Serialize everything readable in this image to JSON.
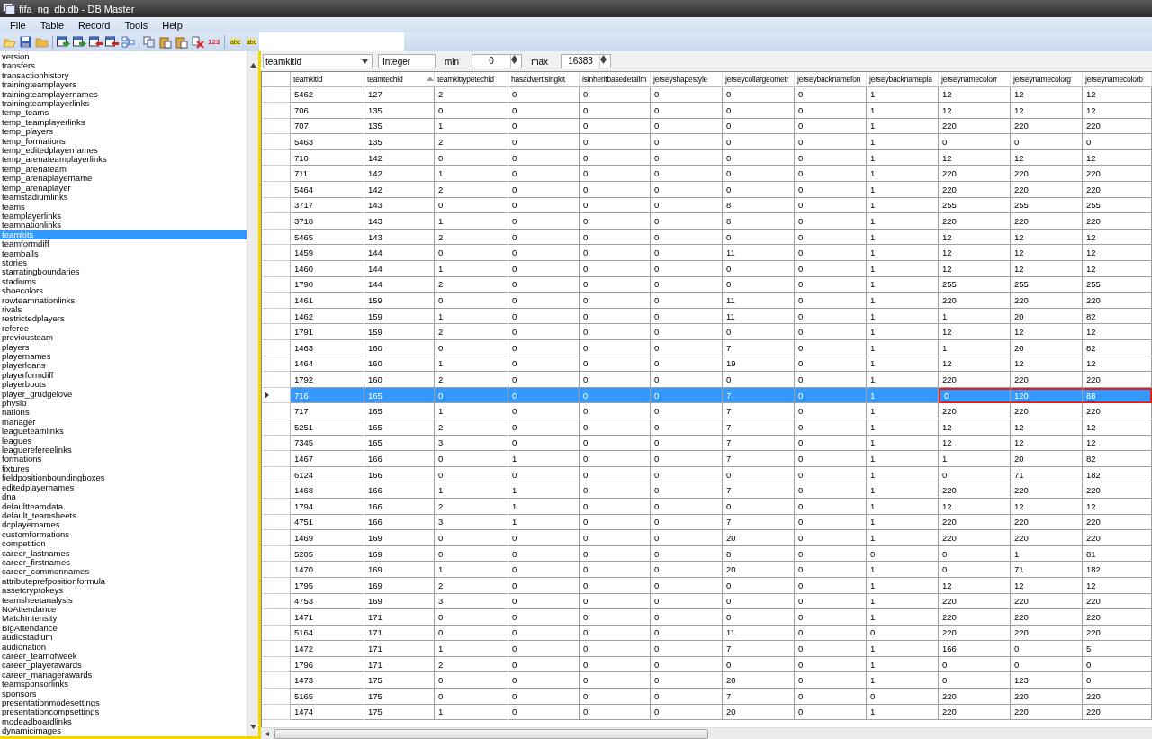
{
  "window": {
    "title": "fifa_ng_db.db - DB Master"
  },
  "menu": [
    "File",
    "Table",
    "Record",
    "Tools",
    "Help"
  ],
  "toolbar": [
    {
      "kind": "open"
    },
    {
      "kind": "save"
    },
    {
      "kind": "folder"
    },
    {
      "kind": "separator"
    },
    {
      "kind": "export"
    },
    {
      "kind": "import"
    },
    {
      "kind": "remove"
    },
    {
      "kind": "remove"
    },
    {
      "kind": "tree"
    },
    {
      "kind": "separator"
    },
    {
      "kind": "copy"
    },
    {
      "kind": "paste"
    },
    {
      "kind": "paste"
    },
    {
      "kind": "delete"
    },
    {
      "kind": "text",
      "label": "123"
    },
    {
      "kind": "separator"
    },
    {
      "kind": "find",
      "label": "abc"
    },
    {
      "kind": "find",
      "label": "abc"
    }
  ],
  "tables": [
    {
      "name": "version",
      "selected": false
    },
    {
      "name": "transfers",
      "selected": false
    },
    {
      "name": "transactionhistory",
      "selected": false
    },
    {
      "name": "trainingteamplayers",
      "selected": false
    },
    {
      "name": "trainingteamplayernames",
      "selected": false
    },
    {
      "name": "trainingteamplayerlinks",
      "selected": false
    },
    {
      "name": "temp_teams",
      "selected": false
    },
    {
      "name": "temp_teamplayerlinks",
      "selected": false
    },
    {
      "name": "temp_players",
      "selected": false
    },
    {
      "name": "temp_formations",
      "selected": false
    },
    {
      "name": "temp_editedplayernames",
      "selected": false
    },
    {
      "name": "temp_arenateamplayerlinks",
      "selected": false
    },
    {
      "name": "temp_arenateam",
      "selected": false
    },
    {
      "name": "temp_arenaplayername",
      "selected": false
    },
    {
      "name": "temp_arenaplayer",
      "selected": false
    },
    {
      "name": "teamstadiumlinks",
      "selected": false
    },
    {
      "name": "teams",
      "selected": false
    },
    {
      "name": "teamplayerlinks",
      "selected": false
    },
    {
      "name": "teamnationlinks",
      "selected": false
    },
    {
      "name": "teamkits",
      "selected": true
    },
    {
      "name": "teamformdiff",
      "selected": false
    },
    {
      "name": "teamballs",
      "selected": false
    },
    {
      "name": "stories",
      "selected": false
    },
    {
      "name": "starratingboundaries",
      "selected": false
    },
    {
      "name": "stadiums",
      "selected": false
    },
    {
      "name": "shoecolors",
      "selected": false
    },
    {
      "name": "rowteamnationlinks",
      "selected": false
    },
    {
      "name": "rivals",
      "selected": false
    },
    {
      "name": "restrictedplayers",
      "selected": false
    },
    {
      "name": "referee",
      "selected": false
    },
    {
      "name": "previousteam",
      "selected": false
    },
    {
      "name": "players",
      "selected": false
    },
    {
      "name": "playernames",
      "selected": false
    },
    {
      "name": "playerloans",
      "selected": false
    },
    {
      "name": "playerformdiff",
      "selected": false
    },
    {
      "name": "playerboots",
      "selected": false
    },
    {
      "name": "player_grudgelove",
      "selected": false
    },
    {
      "name": "physio",
      "selected": false
    },
    {
      "name": "nations",
      "selected": false
    },
    {
      "name": "manager",
      "selected": false
    },
    {
      "name": "leagueteamlinks",
      "selected": false
    },
    {
      "name": "leagues",
      "selected": false
    },
    {
      "name": "leaguerefereelinks",
      "selected": false
    },
    {
      "name": "formations",
      "selected": false
    },
    {
      "name": "fixtures",
      "selected": false
    },
    {
      "name": "fieldpositionboundingboxes",
      "selected": false
    },
    {
      "name": "editedplayernames",
      "selected": false
    },
    {
      "name": "dna",
      "selected": false
    },
    {
      "name": "defaultteamdata",
      "selected": false
    },
    {
      "name": "default_teamsheets",
      "selected": false
    },
    {
      "name": "dcplayernames",
      "selected": false
    },
    {
      "name": "customformations",
      "selected": false
    },
    {
      "name": "competition",
      "selected": false
    },
    {
      "name": "career_lastnames",
      "selected": false
    },
    {
      "name": "career_firstnames",
      "selected": false
    },
    {
      "name": "career_commonnames",
      "selected": false
    },
    {
      "name": "attributeprefpositionformula",
      "selected": false
    },
    {
      "name": "assetcryptokeys",
      "selected": false
    },
    {
      "name": "teamsheetanalysis",
      "selected": false
    },
    {
      "name": "NoAttendance",
      "selected": false
    },
    {
      "name": "MatchIntensity",
      "selected": false
    },
    {
      "name": "BigAttendance",
      "selected": false
    },
    {
      "name": "audiostadium",
      "selected": false
    },
    {
      "name": "audionation",
      "selected": false
    },
    {
      "name": "career_teamofweek",
      "selected": false
    },
    {
      "name": "career_playerawards",
      "selected": false
    },
    {
      "name": "career_managerawards",
      "selected": false
    },
    {
      "name": "teamsponsorlinks",
      "selected": false
    },
    {
      "name": "sponsors",
      "selected": false
    },
    {
      "name": "presentationmodesettings",
      "selected": false
    },
    {
      "name": "presentationcompsettings",
      "selected": false
    },
    {
      "name": "modeadboardlinks",
      "selected": false
    },
    {
      "name": "dynamicimages",
      "selected": false
    }
  ],
  "field_bar": {
    "field": "teamkitid",
    "type": "Integer",
    "min_label": "min",
    "min": "0",
    "max_label": "max",
    "max": "16383"
  },
  "table": {
    "columns": [
      {
        "label": "teamkitid",
        "sorted": false
      },
      {
        "label": "teamtechid",
        "sorted": true
      },
      {
        "label": "teamkittypetechid",
        "sorted": false
      },
      {
        "label": "hasadvertisingkit",
        "sorted": false
      },
      {
        "label": "isinheritbasedetailm",
        "sorted": false
      },
      {
        "label": "jerseyshapestyle",
        "sorted": false
      },
      {
        "label": "jerseycollargeometr",
        "sorted": false
      },
      {
        "label": "jerseybacknamefon",
        "sorted": false
      },
      {
        "label": "jerseybacknamepla",
        "sorted": false
      },
      {
        "label": "jerseynamecolorr",
        "sorted": false
      },
      {
        "label": "jerseynamecolorg",
        "sorted": false
      },
      {
        "label": "jerseynamecolorb",
        "sorted": false
      }
    ],
    "rows": [
      {
        "cells": [
          "5462",
          "127",
          "2",
          "0",
          "0",
          "0",
          "0",
          "0",
          "1",
          "12",
          "12",
          "12"
        ],
        "selected": false
      },
      {
        "cells": [
          "706",
          "135",
          "0",
          "0",
          "0",
          "0",
          "0",
          "0",
          "1",
          "12",
          "12",
          "12"
        ],
        "selected": false
      },
      {
        "cells": [
          "707",
          "135",
          "1",
          "0",
          "0",
          "0",
          "0",
          "0",
          "1",
          "220",
          "220",
          "220"
        ],
        "selected": false
      },
      {
        "cells": [
          "5463",
          "135",
          "2",
          "0",
          "0",
          "0",
          "0",
          "0",
          "1",
          "0",
          "0",
          "0"
        ],
        "selected": false
      },
      {
        "cells": [
          "710",
          "142",
          "0",
          "0",
          "0",
          "0",
          "0",
          "0",
          "1",
          "12",
          "12",
          "12"
        ],
        "selected": false
      },
      {
        "cells": [
          "711",
          "142",
          "1",
          "0",
          "0",
          "0",
          "0",
          "0",
          "1",
          "220",
          "220",
          "220"
        ],
        "selected": false
      },
      {
        "cells": [
          "5464",
          "142",
          "2",
          "0",
          "0",
          "0",
          "0",
          "0",
          "1",
          "220",
          "220",
          "220"
        ],
        "selected": false
      },
      {
        "cells": [
          "3717",
          "143",
          "0",
          "0",
          "0",
          "0",
          "8",
          "0",
          "1",
          "255",
          "255",
          "255"
        ],
        "selected": false
      },
      {
        "cells": [
          "3718",
          "143",
          "1",
          "0",
          "0",
          "0",
          "8",
          "0",
          "1",
          "220",
          "220",
          "220"
        ],
        "selected": false
      },
      {
        "cells": [
          "5465",
          "143",
          "2",
          "0",
          "0",
          "0",
          "0",
          "0",
          "1",
          "12",
          "12",
          "12"
        ],
        "selected": false
      },
      {
        "cells": [
          "1459",
          "144",
          "0",
          "0",
          "0",
          "0",
          "11",
          "0",
          "1",
          "12",
          "12",
          "12"
        ],
        "selected": false
      },
      {
        "cells": [
          "1460",
          "144",
          "1",
          "0",
          "0",
          "0",
          "0",
          "0",
          "1",
          "12",
          "12",
          "12"
        ],
        "selected": false
      },
      {
        "cells": [
          "1790",
          "144",
          "2",
          "0",
          "0",
          "0",
          "0",
          "0",
          "1",
          "255",
          "255",
          "255"
        ],
        "selected": false
      },
      {
        "cells": [
          "1461",
          "159",
          "0",
          "0",
          "0",
          "0",
          "11",
          "0",
          "1",
          "220",
          "220",
          "220"
        ],
        "selected": false
      },
      {
        "cells": [
          "1462",
          "159",
          "1",
          "0",
          "0",
          "0",
          "11",
          "0",
          "1",
          "1",
          "20",
          "82"
        ],
        "selected": false
      },
      {
        "cells": [
          "1791",
          "159",
          "2",
          "0",
          "0",
          "0",
          "0",
          "0",
          "1",
          "12",
          "12",
          "12"
        ],
        "selected": false
      },
      {
        "cells": [
          "1463",
          "160",
          "0",
          "0",
          "0",
          "0",
          "7",
          "0",
          "1",
          "1",
          "20",
          "82"
        ],
        "selected": false
      },
      {
        "cells": [
          "1464",
          "160",
          "1",
          "0",
          "0",
          "0",
          "19",
          "0",
          "1",
          "12",
          "12",
          "12"
        ],
        "selected": false
      },
      {
        "cells": [
          "1792",
          "160",
          "2",
          "0",
          "0",
          "0",
          "0",
          "0",
          "1",
          "220",
          "220",
          "220"
        ],
        "selected": false
      },
      {
        "cells": [
          "716",
          "165",
          "0",
          "0",
          "0",
          "0",
          "7",
          "0",
          "1",
          "0",
          "120",
          "88"
        ],
        "selected": true,
        "outlined": [
          false,
          false,
          false,
          false,
          false,
          false,
          false,
          false,
          false,
          true,
          true,
          true
        ]
      },
      {
        "cells": [
          "717",
          "165",
          "1",
          "0",
          "0",
          "0",
          "7",
          "0",
          "1",
          "220",
          "220",
          "220"
        ],
        "selected": false
      },
      {
        "cells": [
          "5251",
          "165",
          "2",
          "0",
          "0",
          "0",
          "7",
          "0",
          "1",
          "12",
          "12",
          "12"
        ],
        "selected": false
      },
      {
        "cells": [
          "7345",
          "165",
          "3",
          "0",
          "0",
          "0",
          "7",
          "0",
          "1",
          "12",
          "12",
          "12"
        ],
        "selected": false
      },
      {
        "cells": [
          "1467",
          "166",
          "0",
          "1",
          "0",
          "0",
          "7",
          "0",
          "1",
          "1",
          "20",
          "82"
        ],
        "selected": false
      },
      {
        "cells": [
          "6124",
          "166",
          "0",
          "0",
          "0",
          "0",
          "0",
          "0",
          "1",
          "0",
          "71",
          "182"
        ],
        "selected": false
      },
      {
        "cells": [
          "1468",
          "166",
          "1",
          "1",
          "0",
          "0",
          "7",
          "0",
          "1",
          "220",
          "220",
          "220"
        ],
        "selected": false
      },
      {
        "cells": [
          "1794",
          "166",
          "2",
          "1",
          "0",
          "0",
          "0",
          "0",
          "1",
          "12",
          "12",
          "12"
        ],
        "selected": false
      },
      {
        "cells": [
          "4751",
          "166",
          "3",
          "1",
          "0",
          "0",
          "7",
          "0",
          "1",
          "220",
          "220",
          "220"
        ],
        "selected": false
      },
      {
        "cells": [
          "1469",
          "169",
          "0",
          "0",
          "0",
          "0",
          "20",
          "0",
          "1",
          "220",
          "220",
          "220"
        ],
        "selected": false
      },
      {
        "cells": [
          "5205",
          "169",
          "0",
          "0",
          "0",
          "0",
          "8",
          "0",
          "0",
          "0",
          "1",
          "81"
        ],
        "selected": false
      },
      {
        "cells": [
          "1470",
          "169",
          "1",
          "0",
          "0",
          "0",
          "20",
          "0",
          "1",
          "0",
          "71",
          "182"
        ],
        "selected": false
      },
      {
        "cells": [
          "1795",
          "169",
          "2",
          "0",
          "0",
          "0",
          "0",
          "0",
          "1",
          "12",
          "12",
          "12"
        ],
        "selected": false
      },
      {
        "cells": [
          "4753",
          "169",
          "3",
          "0",
          "0",
          "0",
          "0",
          "0",
          "1",
          "220",
          "220",
          "220"
        ],
        "selected": false
      },
      {
        "cells": [
          "1471",
          "171",
          "0",
          "0",
          "0",
          "0",
          "0",
          "0",
          "1",
          "220",
          "220",
          "220"
        ],
        "selected": false
      },
      {
        "cells": [
          "5164",
          "171",
          "0",
          "0",
          "0",
          "0",
          "11",
          "0",
          "0",
          "220",
          "220",
          "220"
        ],
        "selected": false
      },
      {
        "cells": [
          "1472",
          "171",
          "1",
          "0",
          "0",
          "0",
          "7",
          "0",
          "1",
          "166",
          "0",
          "5"
        ],
        "selected": false
      },
      {
        "cells": [
          "1796",
          "171",
          "2",
          "0",
          "0",
          "0",
          "0",
          "0",
          "1",
          "0",
          "0",
          "0"
        ],
        "selected": false
      },
      {
        "cells": [
          "1473",
          "175",
          "0",
          "0",
          "0",
          "0",
          "20",
          "0",
          "1",
          "0",
          "123",
          "0"
        ],
        "selected": false
      },
      {
        "cells": [
          "5165",
          "175",
          "0",
          "0",
          "0",
          "0",
          "7",
          "0",
          "0",
          "220",
          "220",
          "220"
        ],
        "selected": false
      },
      {
        "cells": [
          "1474",
          "175",
          "1",
          "0",
          "0",
          "0",
          "20",
          "0",
          "1",
          "220",
          "220",
          "220"
        ],
        "selected": false
      }
    ]
  }
}
